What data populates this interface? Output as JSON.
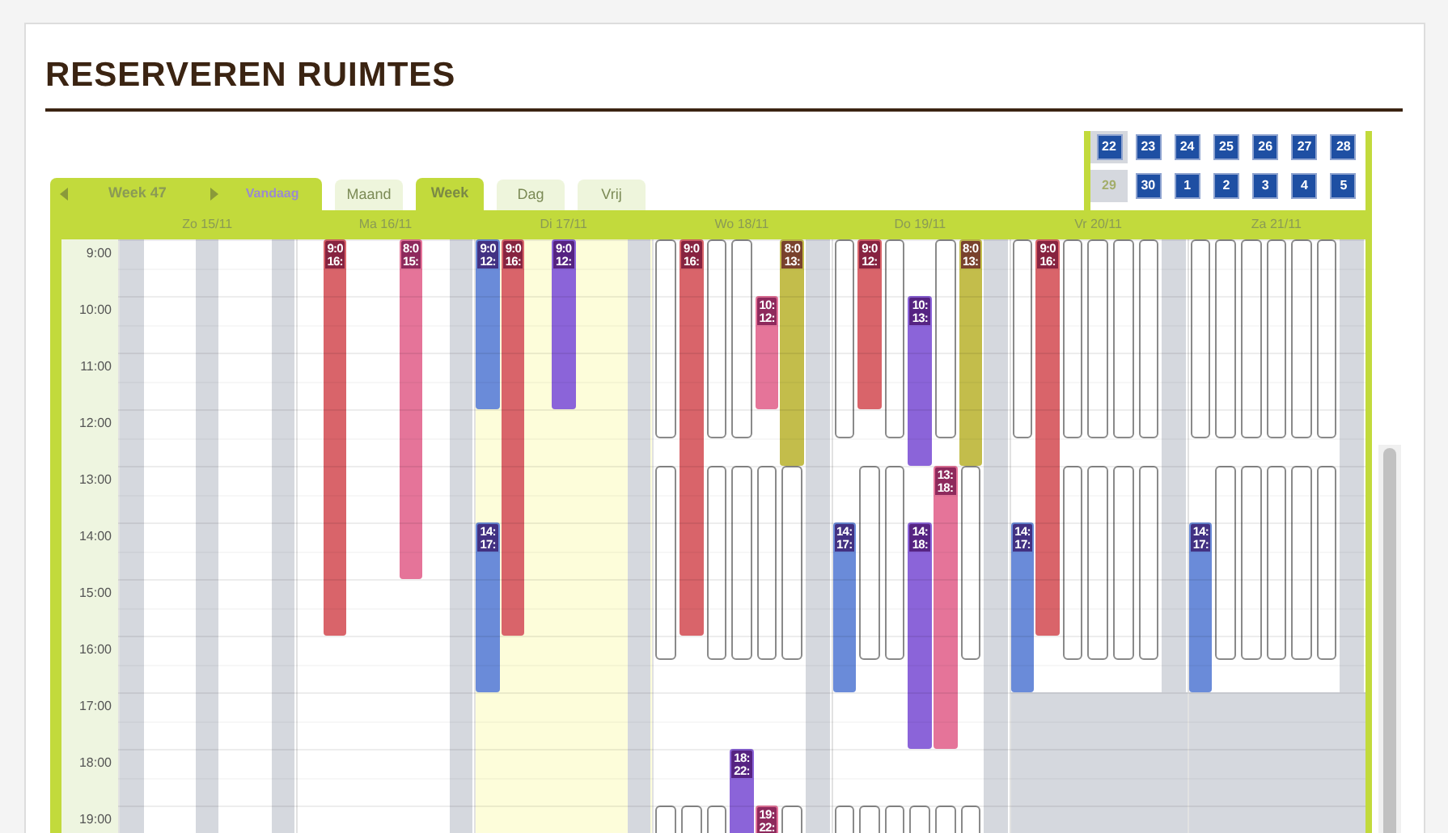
{
  "page": {
    "title": "RESERVEREN RUIMTES"
  },
  "navigation": {
    "week_label": "Week 47",
    "today_link": "Vandaag"
  },
  "tabs": [
    {
      "label": "Maand",
      "selected": false
    },
    {
      "label": "Week",
      "selected": true
    },
    {
      "label": "Dag",
      "selected": false
    },
    {
      "label": "Vrij",
      "selected": false
    }
  ],
  "mini_calendar": {
    "weeks": [
      [
        {
          "label": "22",
          "kind": "link"
        },
        {
          "label": "23",
          "kind": "link"
        },
        {
          "label": "24",
          "kind": "link"
        },
        {
          "label": "25",
          "kind": "link"
        },
        {
          "label": "26",
          "kind": "link"
        },
        {
          "label": "27",
          "kind": "link"
        },
        {
          "label": "28",
          "kind": "link"
        }
      ],
      [
        {
          "label": "29",
          "kind": "plain"
        },
        {
          "label": "30",
          "kind": "link"
        },
        {
          "label": "1",
          "kind": "link"
        },
        {
          "label": "2",
          "kind": "link"
        },
        {
          "label": "3",
          "kind": "link"
        },
        {
          "label": "4",
          "kind": "link"
        },
        {
          "label": "5",
          "kind": "link"
        }
      ]
    ]
  },
  "hours": [
    "9:00",
    "10:00",
    "11:00",
    "12:00",
    "13:00",
    "14:00",
    "15:00",
    "16:00",
    "17:00",
    "18:00",
    "19:00"
  ],
  "days": [
    {
      "label": "Zo 15/11",
      "today": false,
      "closed_evening": false,
      "slots": [
        {
          "kind": "closed"
        },
        {
          "kind": "open"
        },
        {
          "kind": "open"
        },
        {
          "kind": "closed"
        },
        {
          "kind": "open"
        },
        {
          "kind": "open"
        },
        {
          "kind": "closed"
        }
      ]
    },
    {
      "label": "Ma 16/11",
      "today": false,
      "closed_evening": false,
      "slots": [
        {
          "kind": "open"
        },
        {
          "kind": "open",
          "blocks": [
            {
              "kind": "event",
              "color": "#d9646a",
              "labels": [
                "9:0",
                "16:"
              ]
            }
          ]
        },
        {
          "kind": "open"
        },
        {
          "kind": "open"
        },
        {
          "kind": "open",
          "blocks": [
            {
              "kind": "event",
              "color": "#e57499",
              "labels": [
                "8:0",
                "15:"
              ]
            }
          ]
        },
        {
          "kind": "open"
        },
        {
          "kind": "closed"
        }
      ]
    },
    {
      "label": "Di 17/11",
      "today": true,
      "closed_evening": false,
      "slots": [
        {
          "kind": "open",
          "blocks": [
            {
              "kind": "event",
              "color": "#6a8bd9",
              "labels": [
                "9:0",
                "12:"
              ]
            },
            {
              "kind": "event",
              "color": "#6a8bd9",
              "labels": [
                "14:",
                "17:"
              ]
            }
          ]
        },
        {
          "kind": "open",
          "blocks": [
            {
              "kind": "event",
              "color": "#d9646a",
              "labels": [
                "9:0",
                "16:"
              ]
            }
          ]
        },
        {
          "kind": "open"
        },
        {
          "kind": "open",
          "blocks": [
            {
              "kind": "event",
              "color": "#8b64d9",
              "labels": [
                "9:0",
                "12:"
              ]
            }
          ]
        },
        {
          "kind": "open"
        },
        {
          "kind": "open"
        },
        {
          "kind": "closed"
        }
      ]
    },
    {
      "label": "Wo 18/11",
      "today": false,
      "closed_evening": false,
      "slots": [
        {
          "kind": "open",
          "blocks": [
            {
              "kind": "morning"
            },
            {
              "kind": "afternoon"
            },
            {
              "kind": "evening"
            }
          ]
        },
        {
          "kind": "open",
          "blocks": [
            {
              "kind": "event",
              "color": "#d9646a",
              "labels": [
                "9:0",
                "16:"
              ]
            },
            {
              "kind": "evening"
            }
          ]
        },
        {
          "kind": "open",
          "blocks": [
            {
              "kind": "morning"
            },
            {
              "kind": "afternoon"
            },
            {
              "kind": "evening"
            }
          ]
        },
        {
          "kind": "open",
          "blocks": [
            {
              "kind": "morning"
            },
            {
              "kind": "afternoon"
            },
            {
              "kind": "event",
              "color": "#8b64d9",
              "labels": [
                "18:",
                "22:"
              ]
            }
          ]
        },
        {
          "kind": "open",
          "blocks": [
            {
              "kind": "event",
              "color": "#e57499",
              "labels": [
                "10:",
                "12:"
              ]
            },
            {
              "kind": "afternoon"
            },
            {
              "kind": "event",
              "color": "#e57499",
              "labels": [
                "19:",
                "22:"
              ]
            }
          ]
        },
        {
          "kind": "open",
          "blocks": [
            {
              "kind": "event",
              "color": "#c3bd4b",
              "labels": [
                "8:0",
                "13:"
              ]
            },
            {
              "kind": "afternoon"
            },
            {
              "kind": "evening"
            }
          ]
        },
        {
          "kind": "closed"
        }
      ]
    },
    {
      "label": "Do 19/11",
      "today": false,
      "closed_evening": false,
      "slots": [
        {
          "kind": "open",
          "blocks": [
            {
              "kind": "morning"
            },
            {
              "kind": "event",
              "color": "#6a8bd9",
              "labels": [
                "14:",
                "17:"
              ]
            },
            {
              "kind": "evening"
            }
          ]
        },
        {
          "kind": "open",
          "blocks": [
            {
              "kind": "event",
              "color": "#d9646a",
              "labels": [
                "9:0",
                "12:"
              ]
            },
            {
              "kind": "afternoon"
            },
            {
              "kind": "evening"
            }
          ]
        },
        {
          "kind": "open",
          "blocks": [
            {
              "kind": "morning"
            },
            {
              "kind": "afternoon"
            },
            {
              "kind": "evening"
            }
          ]
        },
        {
          "kind": "open",
          "blocks": [
            {
              "kind": "event",
              "color": "#8b64d9",
              "labels": [
                "10:",
                "13:"
              ]
            },
            {
              "kind": "event",
              "color": "#8b64d9",
              "labels": [
                "14:",
                "18:"
              ]
            },
            {
              "kind": "evening"
            }
          ]
        },
        {
          "kind": "open",
          "blocks": [
            {
              "kind": "morning"
            },
            {
              "kind": "event",
              "color": "#e57499",
              "labels": [
                "13:",
                "18:"
              ]
            },
            {
              "kind": "evening"
            }
          ]
        },
        {
          "kind": "open",
          "blocks": [
            {
              "kind": "event",
              "color": "#c3bd4b",
              "labels": [
                "8:0",
                "13:"
              ]
            },
            {
              "kind": "afternoon"
            },
            {
              "kind": "evening"
            }
          ]
        },
        {
          "kind": "closed"
        }
      ]
    },
    {
      "label": "Vr 20/11",
      "today": false,
      "closed_evening": true,
      "slots": [
        {
          "kind": "open",
          "blocks": [
            {
              "kind": "morning"
            },
            {
              "kind": "event",
              "color": "#6a8bd9",
              "labels": [
                "14:",
                "17:"
              ]
            }
          ]
        },
        {
          "kind": "open",
          "blocks": [
            {
              "kind": "event",
              "color": "#d9646a",
              "labels": [
                "9:0",
                "16:"
              ]
            }
          ]
        },
        {
          "kind": "open",
          "blocks": [
            {
              "kind": "morning"
            },
            {
              "kind": "afternoon"
            }
          ]
        },
        {
          "kind": "open",
          "blocks": [
            {
              "kind": "morning"
            },
            {
              "kind": "afternoon"
            }
          ]
        },
        {
          "kind": "open",
          "blocks": [
            {
              "kind": "morning"
            },
            {
              "kind": "afternoon"
            }
          ]
        },
        {
          "kind": "open",
          "blocks": [
            {
              "kind": "morning"
            },
            {
              "kind": "afternoon"
            }
          ]
        },
        {
          "kind": "closed"
        }
      ]
    },
    {
      "label": "Za 21/11",
      "today": false,
      "closed_evening": true,
      "slots": [
        {
          "kind": "open",
          "blocks": [
            {
              "kind": "morning"
            },
            {
              "kind": "event",
              "color": "#6a8bd9",
              "labels": [
                "14:",
                "17:"
              ]
            }
          ]
        },
        {
          "kind": "open",
          "blocks": [
            {
              "kind": "morning"
            },
            {
              "kind": "afternoon"
            }
          ]
        },
        {
          "kind": "open",
          "blocks": [
            {
              "kind": "morning"
            },
            {
              "kind": "afternoon"
            }
          ]
        },
        {
          "kind": "open",
          "blocks": [
            {
              "kind": "morning"
            },
            {
              "kind": "afternoon"
            }
          ]
        },
        {
          "kind": "open",
          "blocks": [
            {
              "kind": "morning"
            },
            {
              "kind": "afternoon"
            }
          ]
        },
        {
          "kind": "open",
          "blocks": [
            {
              "kind": "morning"
            },
            {
              "kind": "afternoon"
            }
          ]
        },
        {
          "kind": "closed"
        }
      ]
    }
  ]
}
